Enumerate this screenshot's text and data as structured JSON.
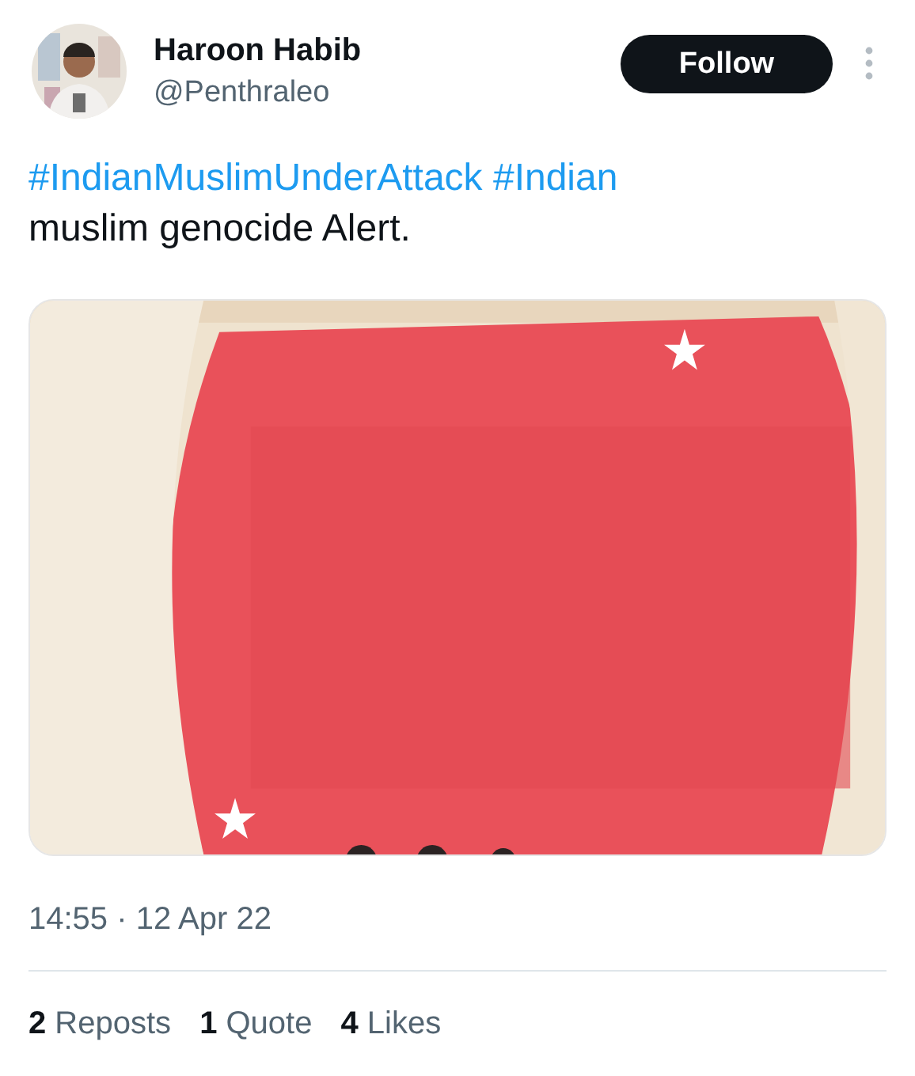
{
  "author": {
    "name": "Haroon Habib",
    "handle": "@Penthraleo"
  },
  "follow_button": "Follow",
  "tweet": {
    "text_parts": [
      {
        "kind": "hashtag",
        "text": "#IndianMuslimUnderAttack"
      },
      {
        "kind": "hashtag",
        "text": "#Indian"
      },
      {
        "kind": "plain",
        "text": "muslim genocide Alert."
      }
    ]
  },
  "timestamp": "14:55 · 12 Apr 22",
  "stats": [
    "**2** Reposts",
    "**1** Quote",
    "**4** Likes"
  ]
}
